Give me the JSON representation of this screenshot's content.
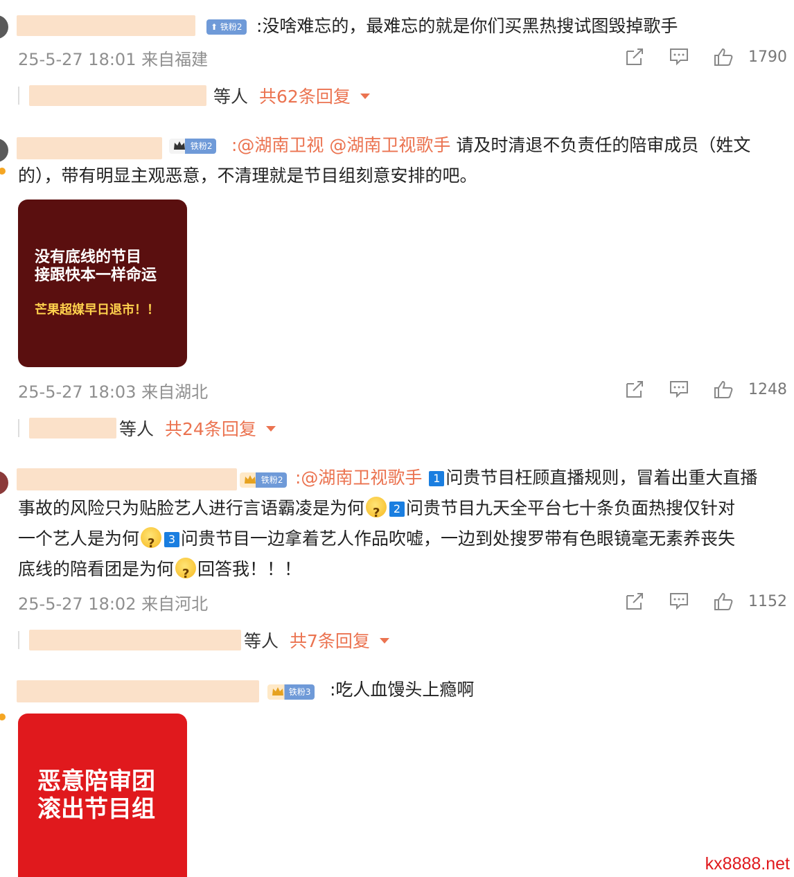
{
  "comments": [
    {
      "badge": "铁粉2",
      "text": ":没啥难忘的，最难忘的就是你们买黑热搜试图毁掉歌手",
      "time": "25-5-27 18:01",
      "location": "来自福建",
      "likes": "1790",
      "reply_who": "等人",
      "reply_count": "共62条回复"
    },
    {
      "badge": "铁粉2",
      "mention1": ":@湖南卫视",
      "mention2": "@湖南卫视歌手",
      "text_line1": "请及时清退不负责任的陪审成员（姓文",
      "text_line2": "的），带有明显主观恶意，不清理就是节目组刻意安排的吧。",
      "image": {
        "line1": "没有底线的节目",
        "line2": "接跟快本一样命运",
        "line3": "芒果超媒早日退市！！"
      },
      "time": "25-5-27 18:03",
      "location": "来自湖北",
      "likes": "1248",
      "reply_who": "等人",
      "reply_count": "共24条回复"
    },
    {
      "badge": "铁粉2",
      "mention": ":@湖南卫视歌手",
      "n1": "1",
      "seg1": "问贵节目枉顾直播规则，冒着出重大直播",
      "seg2": "事故的风险只为贴脸艺人进行言语霸凌是为何",
      "n2": "2",
      "seg3": "问贵节目九天全平台七十条负面热搜仅针对",
      "seg4": "一个艺人是为何",
      "n3": "3",
      "seg5": "问贵节目一边拿着艺人作品吹嘘，一边到处搜罗带有色眼镜毫无素养丧失",
      "seg6": "底线的陪看团是为何",
      "seg7": "回答我！！！",
      "time": "25-5-27 18:02",
      "location": "来自河北",
      "likes": "1152",
      "reply_who": "等人",
      "reply_count": "共7条回复"
    },
    {
      "badge": "铁粉3",
      "text": ":吃人血馒头上瘾啊",
      "image": {
        "line1": "恶意陪审团",
        "line2": "滚出节目组"
      }
    }
  ],
  "watermark": "kx8888.net",
  "colors": {
    "accent": "#eb7350",
    "badge": "#6f9ad8",
    "link_blue": "#1a7ee0"
  },
  "icons": [
    "share-icon",
    "comment-icon",
    "like-icon",
    "crown-icon",
    "caret-down-icon"
  ]
}
